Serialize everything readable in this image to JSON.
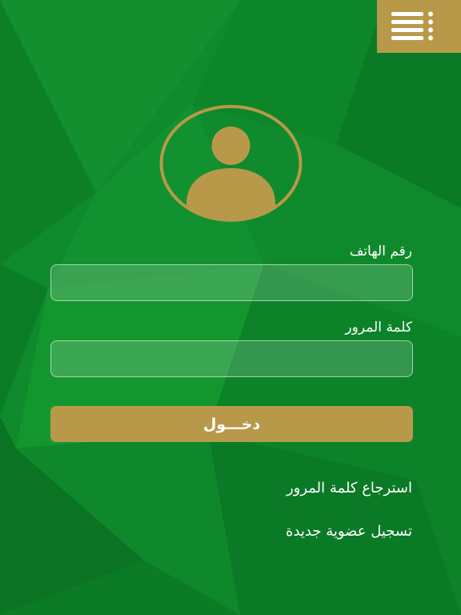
{
  "colors": {
    "background": "#0f8a2c",
    "accent": "#b8994a",
    "text": "#ffffff"
  },
  "header": {
    "menu_icon": "menu-icon"
  },
  "avatar": {
    "icon": "user-icon"
  },
  "form": {
    "phone_label": "رقم الهاتف",
    "phone_value": "",
    "password_label": "كلمة المرور",
    "password_value": "",
    "login_label": "دخـــول"
  },
  "links": {
    "forgot_password": "استرجاع كلمة المرور",
    "register": "تسجيل عضوية جديدة"
  }
}
